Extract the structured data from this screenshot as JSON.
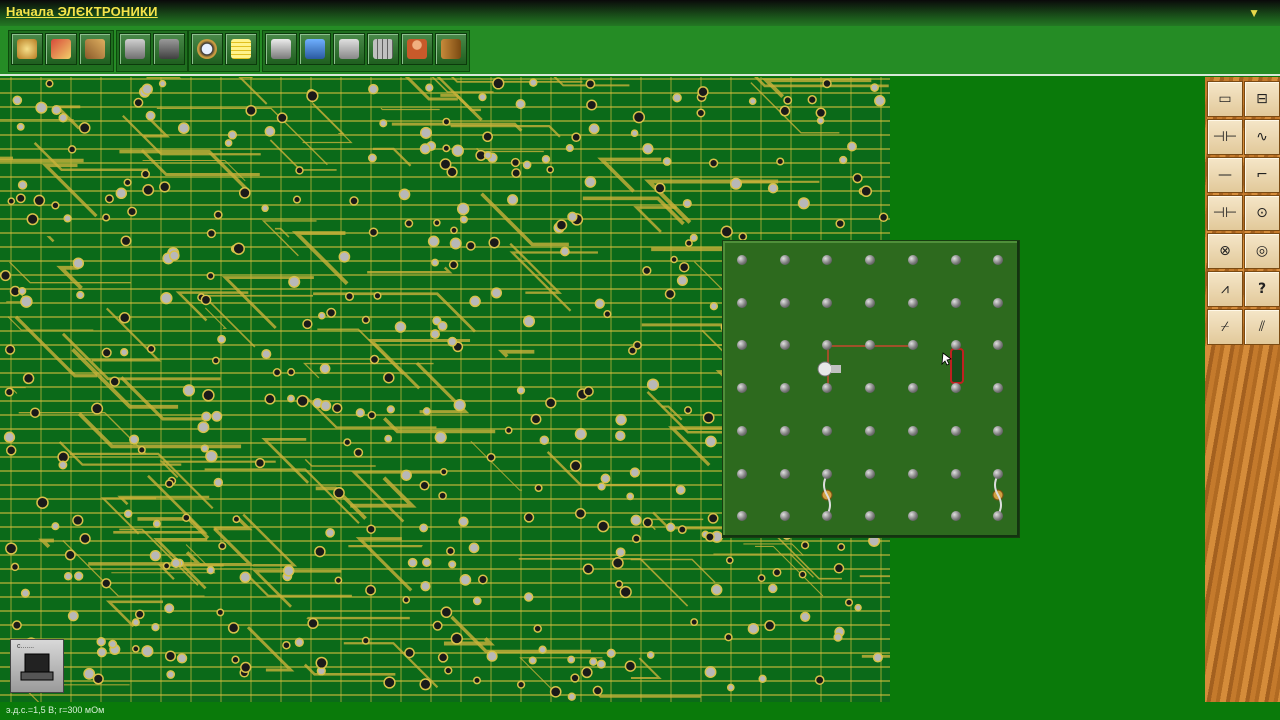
{
  "app": {
    "title": "Начала ЭЛЄКТРОНИКИ",
    "menu_icon": "filter-triangle-icon"
  },
  "toolbar": {
    "groups": [
      [
        "new-circuit-icon",
        "open-file-icon",
        "tools-icon"
      ],
      [
        "meter-icon",
        "oscilloscope-icon"
      ],
      [
        "magnifier-icon",
        "notes-icon"
      ],
      [
        "books-icon",
        "lab-icon",
        "printer-icon",
        "calculator-icon",
        "teacher-icon",
        "exit-door-icon"
      ]
    ]
  },
  "palette": {
    "items": [
      "resistor-icon",
      "fuse-icon",
      "capacitor-icon",
      "inductor-icon",
      "wire-icon",
      "switch-icon",
      "battery-icon",
      "ammeter-icon",
      "lamp-icon",
      "voltmeter-icon",
      "rheostat-icon",
      "unknown-icon",
      "variable-resistor-icon",
      "variable-capacitor-icon"
    ],
    "unknown_label": "?"
  },
  "board": {
    "rows": 7,
    "cols": 7
  },
  "corner_button": {
    "label": "с.......",
    "icon": "computer-icon"
  },
  "status": {
    "text": "э.д.с.=1,5 В; r=300 мОм"
  },
  "colors": {
    "title": "#f5e44a",
    "board": "#2d6a1e",
    "background": "#0a7a0a"
  }
}
